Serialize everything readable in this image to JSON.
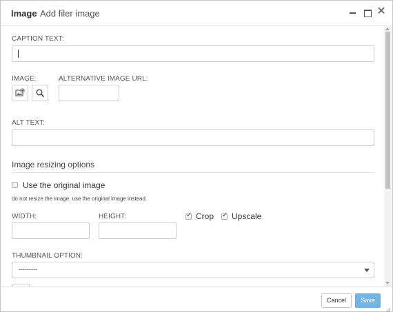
{
  "header": {
    "title": "Image",
    "subtitle": "Add filer image"
  },
  "form": {
    "caption_label": "CAPTION TEXT:",
    "caption_value": "",
    "image_label": "IMAGE:",
    "alt_url_label": "ALTERNATIVE IMAGE URL:",
    "alt_url_value": "",
    "alt_text_label": "ALT TEXT:",
    "alt_text_value": "",
    "resizing_title": "Image resizing options",
    "use_original_label": "Use the original image",
    "use_original_checked": false,
    "use_original_help": "do not resize the image. use the original image instead.",
    "width_label": "WIDTH:",
    "width_value": "",
    "height_label": "HEIGHT:",
    "height_value": "",
    "crop_label": "Crop",
    "crop_checked": true,
    "upscale_label": "Upscale",
    "upscale_checked": true,
    "thumbnail_label": "THUMBNAIL OPTION:",
    "thumbnail_selected": "---------"
  },
  "footer": {
    "cancel_label": "Cancel",
    "save_label": "Save"
  },
  "colors": {
    "save_button": "#72b5e5",
    "border": "#cccccc"
  },
  "icons": [
    "minimize-icon",
    "maximize-icon",
    "close-icon",
    "image-add-icon",
    "search-icon",
    "checkbox-icon",
    "chevron-down-icon",
    "resize-grip-icon"
  ]
}
